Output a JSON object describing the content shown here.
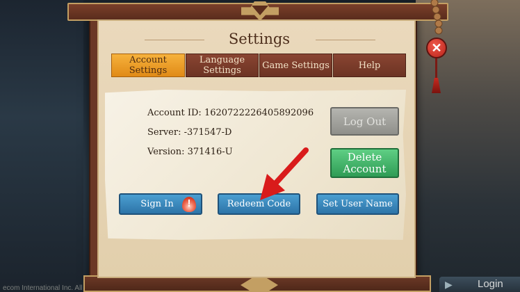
{
  "title": "Settings",
  "tabs": [
    {
      "label": "Account Settings",
      "active": true
    },
    {
      "label": "Language Settings",
      "active": false
    },
    {
      "label": "Game Settings",
      "active": false
    },
    {
      "label": "Help",
      "active": false
    }
  ],
  "account": {
    "id_line": "Account ID: 1620722226405892096",
    "server_line": "Server: -371547-D",
    "version_line": "Version: 371416-U"
  },
  "buttons": {
    "log_out": "Log Out",
    "delete_account": "Delete Account",
    "sign_in": "Sign In",
    "redeem_code": "Redeem Code",
    "set_user_name": "Set User Name"
  },
  "background": {
    "copyright": "ecom International Inc. All Rights Reserved",
    "login": "Login"
  },
  "colors": {
    "active_tab": "#f2a127",
    "inactive_tab": "#7a3a2a",
    "blue_button": "#3585bb",
    "green_button": "#43b86b",
    "grey_button": "#a3a39e",
    "close_button": "#d8392c",
    "annotation_arrow": "#d91b1b"
  },
  "icons": {
    "close": "close-icon",
    "sign_in_badge": "exclamation-flame-icon",
    "arrow": "red-arrow-annotation"
  }
}
